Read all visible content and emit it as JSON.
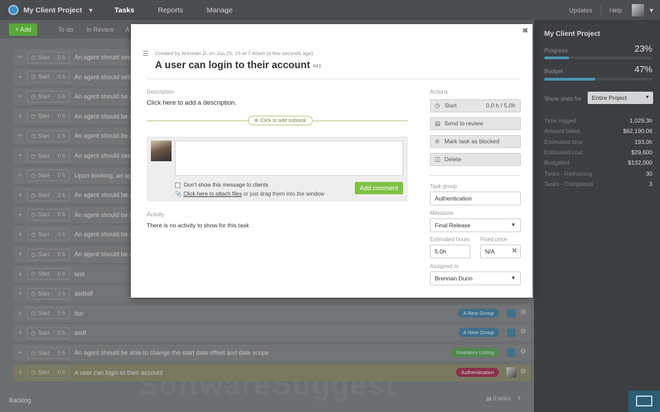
{
  "topbar": {
    "project": "My Client Project",
    "nav": [
      "Tasks",
      "Reports",
      "Manage"
    ],
    "updates": "Updates",
    "help": "Help"
  },
  "toolbar": {
    "add_label": "+ Add",
    "filters": [
      "To do",
      "In Review",
      "A"
    ]
  },
  "tasks": [
    {
      "title": "An agent should see",
      "hours": "0 h"
    },
    {
      "title": "An agent should sele",
      "hours": "0 h"
    },
    {
      "title": "An agent should be a",
      "hours": "0 h"
    },
    {
      "title": "An agent should be a",
      "hours": "0 h"
    },
    {
      "title": "An agent should be a",
      "hours": "0 h"
    },
    {
      "title": "An agent should see",
      "hours": "0 h"
    },
    {
      "title": "Upon booking, an ag",
      "hours": "0 h"
    },
    {
      "title": "An agent should be a",
      "hours": "0 h"
    },
    {
      "title": "An agent should be a",
      "hours": "0 h"
    },
    {
      "title": "An agent should be a",
      "hours": "0 h"
    },
    {
      "title": "An agent should be a",
      "hours": "0 h"
    },
    {
      "title": "test",
      "hours": "0 h"
    },
    {
      "title": "asdsdf",
      "hours": "0 h"
    },
    {
      "title": "foo",
      "hours": "0 h",
      "tag": "A New Group"
    },
    {
      "title": "asdf",
      "hours": "0 h",
      "tag": "A New Group"
    },
    {
      "title": "An agent should be able to change the start date offset and date scope",
      "hours": "0 h",
      "tag": "Inventory Listing"
    },
    {
      "title": "A user can login to their account",
      "hours": "0 h",
      "tag": "Authentication"
    }
  ],
  "start_label": "Start",
  "backlog": {
    "label": "Backlog",
    "count": "0 tasks"
  },
  "watermark": "SoftwareSuggest",
  "sidebar": {
    "title": "My Client Project",
    "progress_label": "Progress",
    "progress_pct": "23%",
    "progress_value": 23,
    "budget_label": "Budget",
    "budget_pct": "47%",
    "budget_value": 47,
    "stats_for_label": "Show stats for",
    "stats_for_value": "Entire Project",
    "stats": [
      {
        "k": "Time logged",
        "v": "1,029.3h"
      },
      {
        "k": "Amount billed",
        "v": "$62,190.06"
      },
      {
        "k": "Estimated time",
        "v": "193.0h"
      },
      {
        "k": "Estimated cost",
        "v": "$29,600"
      },
      {
        "k": "Budgeted",
        "v": "$132,000"
      },
      {
        "k": "Tasks - Remaining",
        "v": "30"
      },
      {
        "k": "Tasks - Completed",
        "v": "3"
      }
    ]
  },
  "modal": {
    "meta": "Created by Brennan D. on Jun 25, 15 at 7:40am (a few seconds ago)",
    "title": "A user can login to their account",
    "number": "#41",
    "description_label": "Description",
    "description_placeholder": "Click here to add a description.",
    "subtask_label": "Click to add subtask",
    "hide_from_clients": "Don't show this message to clients",
    "attach_link": "Click here to attach files",
    "attach_rest": " or just drag them into the window",
    "comment_button": "Add comment",
    "activity_label": "Activity",
    "activity_empty": "There is no activity to show for this task",
    "actions_label": "Actions",
    "start_label": "Start",
    "start_hours": "0.0 h / 5.0h",
    "send_review": "Send to review",
    "mark_blocked": "Mark task as blocked",
    "delete": "Delete",
    "task_group_label": "Task group",
    "task_group": "Authentication",
    "milestone_label": "Milestone",
    "milestone": "Final Release",
    "est_hours_label": "Estimated hours",
    "est_hours": "5.0h",
    "fixed_price_label": "Fixed price",
    "fixed_price": "N/A",
    "assigned_label": "Assigned to",
    "assigned": "Brennan Dunn"
  },
  "colors": {
    "accent_green": "#7fc244",
    "progress_blue": "#4e93b4",
    "auth_tag": "#8a2f47",
    "group_tag": "#3f6f89",
    "inventory_tag": "#4f8a4a"
  }
}
